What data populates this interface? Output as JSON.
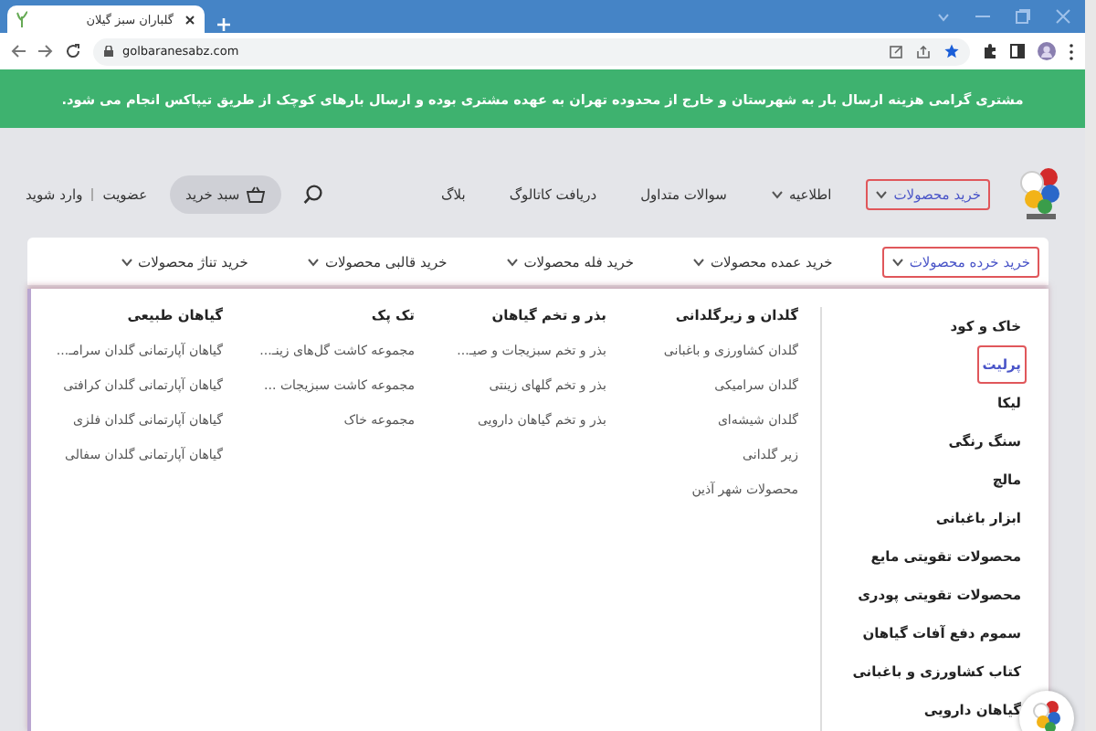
{
  "browser": {
    "tab_title": "گلباران سبز گیلان",
    "url": "golbaranesabz.com"
  },
  "banner": "مشتری گرامی هزینه ارسال بار به شهرستان و خارج از محدوده تهران به عهده مشتری بوده و ارسال بارهای کوچک از طریق تیپاکس انجام می شود.",
  "nav": {
    "items": [
      {
        "label": "خرید محصولات",
        "selected": true,
        "has_menu": true
      },
      {
        "label": "اطلاعیه",
        "selected": false,
        "has_menu": true
      },
      {
        "label": "سوالات متداول",
        "selected": false,
        "has_menu": false
      },
      {
        "label": "دریافت کاتالوگ",
        "selected": false,
        "has_menu": false
      },
      {
        "label": "بلاگ",
        "selected": false,
        "has_menu": false
      }
    ],
    "cart_button": "سبد خرید",
    "signup_link": "عضویت",
    "login_link": "وارد شوید"
  },
  "submenu": [
    {
      "label": "خرید خرده محصولات",
      "selected": true,
      "has_menu": true
    },
    {
      "label": "خرید عمده محصولات",
      "selected": false,
      "has_menu": true
    },
    {
      "label": "خرید فله محصولات",
      "selected": false,
      "has_menu": true
    },
    {
      "label": "خرید قالبی محصولات",
      "selected": false,
      "has_menu": true
    },
    {
      "label": "خرید تناژ محصولات",
      "selected": false,
      "has_menu": true
    }
  ],
  "categories": [
    {
      "label": "خاک و کود",
      "selected": false
    },
    {
      "label": "پرلیت",
      "selected": true
    },
    {
      "label": "لیکا",
      "selected": false
    },
    {
      "label": "سنگ رنگی",
      "selected": false
    },
    {
      "label": "مالچ",
      "selected": false
    },
    {
      "label": "ابزار باغبانی",
      "selected": false
    },
    {
      "label": "محصولات تقویتی مایع",
      "selected": false
    },
    {
      "label": "محصولات تقویتی پودری",
      "selected": false
    },
    {
      "label": "سموم دفع آفات گیاهان",
      "selected": false
    },
    {
      "label": "کتاب کشاورزی و باغبانی",
      "selected": false
    },
    {
      "label": "گیاهان دارویی",
      "selected": false
    }
  ],
  "columns": [
    {
      "title": "گلدان و زیرگلدانی",
      "items": [
        "گلدان کشاورزی و باغبانی",
        "گلدان سرامیکی",
        "گلدان شیشه‌ای",
        "زیر گلدانی",
        "محصولات شهر آذین"
      ]
    },
    {
      "title": "بذر و تخم گیاهان",
      "items": [
        "بذر و تخم سبزیجات و صیـ...",
        "بذر و تخم گلهای زینتی",
        "بذر و تخم گیاهان دارویی"
      ]
    },
    {
      "title": "تک پک",
      "items": [
        "مجموعه کاشت گل‌های زینـ...",
        "مجموعه کاشت سبزیجات ...",
        "مجموعه خاک"
      ]
    },
    {
      "title": "گیاهان طبیعی",
      "items": [
        "گیاهان آپارتمانی گلدان سرامـ...",
        "گیاهان آپارتمانی گلدان کرافتی",
        "گیاهان آپارتمانی گلدان فلزی",
        "گیاهان آپارتمانی گلدان سفالی"
      ]
    }
  ]
}
